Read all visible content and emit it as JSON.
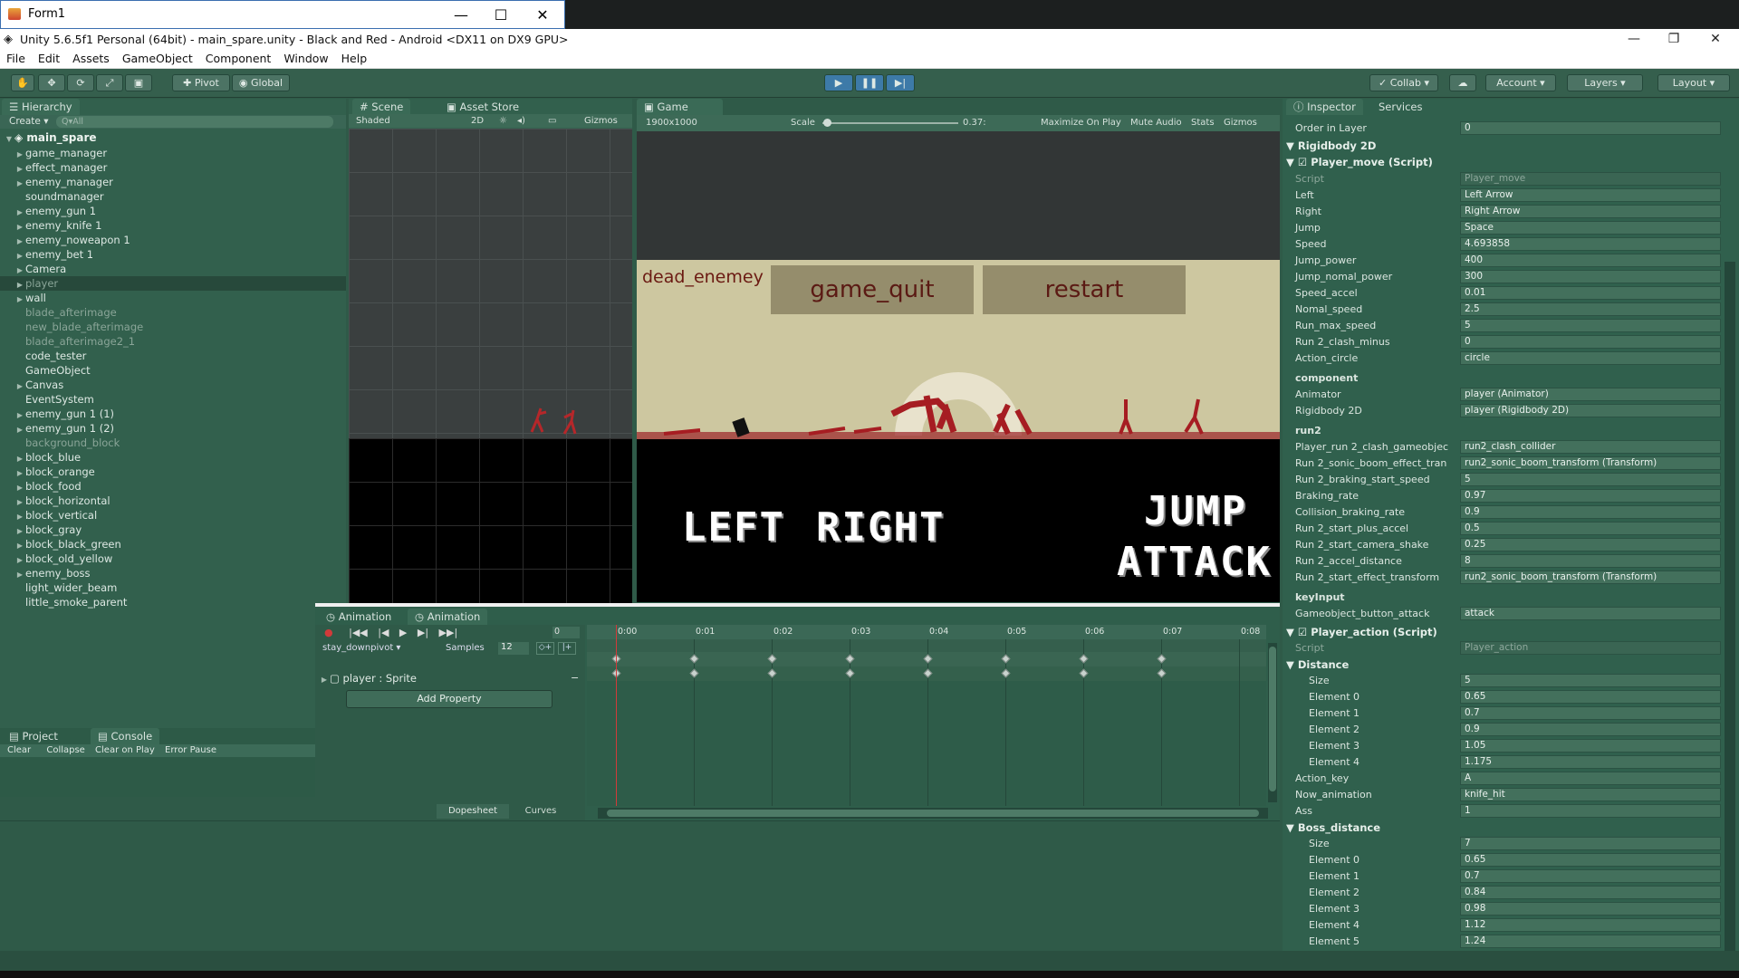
{
  "form_window": {
    "title": "Form1"
  },
  "unity_window": {
    "title": "Unity 5.6.5f1 Personal (64bit) - main_spare.unity - Black and Red - Android <DX11 on DX9 GPU>"
  },
  "menu": [
    "File",
    "Edit",
    "Assets",
    "GameObject",
    "Component",
    "Window",
    "Help"
  ],
  "toolbar": {
    "pivot": "Pivot",
    "global": "Global",
    "collab": "Collab",
    "account": "Account",
    "layers": "Layers",
    "layout": "Layout"
  },
  "hierarchy": {
    "tab": "Hierarchy",
    "create": "Create",
    "search_placeholder": "Q▾All",
    "root": "main_spare",
    "items": [
      {
        "label": "game_manager",
        "arrow": true,
        "dim": false
      },
      {
        "label": "effect_manager",
        "arrow": true,
        "dim": false
      },
      {
        "label": "enemy_manager",
        "arrow": true,
        "dim": false
      },
      {
        "label": "soundmanager",
        "arrow": false,
        "dim": false
      },
      {
        "label": "enemy_gun 1",
        "arrow": true,
        "dim": false
      },
      {
        "label": "enemy_knife 1",
        "arrow": true,
        "dim": false
      },
      {
        "label": "enemy_noweapon 1",
        "arrow": true,
        "dim": false
      },
      {
        "label": "enemy_bet 1",
        "arrow": true,
        "dim": false
      },
      {
        "label": "Camera",
        "arrow": true,
        "dim": false
      },
      {
        "label": "player",
        "arrow": true,
        "dim": true,
        "selected": true
      },
      {
        "label": "wall",
        "arrow": true,
        "dim": false
      },
      {
        "label": "blade_afterimage",
        "arrow": false,
        "dim": true
      },
      {
        "label": "new_blade_afterimage",
        "arrow": false,
        "dim": true
      },
      {
        "label": "blade_afterimage2_1",
        "arrow": false,
        "dim": true
      },
      {
        "label": "code_tester",
        "arrow": false,
        "dim": false
      },
      {
        "label": "GameObject",
        "arrow": false,
        "dim": false
      },
      {
        "label": "Canvas",
        "arrow": true,
        "dim": false
      },
      {
        "label": "EventSystem",
        "arrow": false,
        "dim": false
      },
      {
        "label": "enemy_gun 1 (1)",
        "arrow": true,
        "dim": false
      },
      {
        "label": "enemy_gun 1 (2)",
        "arrow": true,
        "dim": false
      },
      {
        "label": "background_block",
        "arrow": false,
        "dim": true
      },
      {
        "label": "block_blue",
        "arrow": true,
        "dim": false
      },
      {
        "label": "block_orange",
        "arrow": true,
        "dim": false
      },
      {
        "label": "block_food",
        "arrow": true,
        "dim": false
      },
      {
        "label": "block_horizontal",
        "arrow": true,
        "dim": false
      },
      {
        "label": "block_vertical",
        "arrow": true,
        "dim": false
      },
      {
        "label": "block_gray",
        "arrow": true,
        "dim": false
      },
      {
        "label": "block_black_green",
        "arrow": true,
        "dim": false
      },
      {
        "label": "block_old_yellow",
        "arrow": true,
        "dim": false
      },
      {
        "label": "enemy_boss",
        "arrow": true,
        "dim": false
      },
      {
        "label": "light_wider_beam",
        "arrow": false,
        "dim": false
      },
      {
        "label": "little_smoke_parent",
        "arrow": false,
        "dim": false
      }
    ]
  },
  "scene": {
    "tab": "Scene",
    "asset_tab": "Asset Store",
    "shaded": "Shaded",
    "mode2d": "2D",
    "gizmos": "Gizmos"
  },
  "game": {
    "tab": "Game",
    "resolution": "1900x1000",
    "scale_label": "Scale",
    "scale_value": "0.37:",
    "maximize": "Maximize On Play",
    "mute": "Mute Audio",
    "stats": "Stats",
    "gizmos": "Gizmos",
    "dead_label": "dead_enemey",
    "quit_btn": "game_quit",
    "restart_btn": "restart",
    "left": "LEFT",
    "right": "RIGHT",
    "jump": "JUMP",
    "attack": "ATTACK"
  },
  "project": {
    "tab": "Project",
    "console_tab": "Console",
    "clear": "Clear",
    "collapse": "Collapse",
    "clear_on_play": "Clear on Play",
    "error_pause": "Error Pause"
  },
  "animation": {
    "tab1": "Animation",
    "tab2": "Animation",
    "frame": "0",
    "clip": "stay_downpivot",
    "samples_label": "Samples",
    "samples": "12",
    "property": "player : Sprite",
    "add_property": "Add Property",
    "dopesheet": "Dopesheet",
    "curves": "Curves",
    "times": [
      "0:00",
      "0:01",
      "0:02",
      "0:03",
      "0:04",
      "0:05",
      "0:06",
      "0:07",
      "0:08"
    ]
  },
  "inspector": {
    "tab": "Inspector",
    "services_tab": "Services",
    "order_label": "Order in Layer",
    "order_value": "0",
    "rigidbody": "Rigidbody 2D",
    "player_move": "Player_move (Script)",
    "fields1": [
      {
        "label": "Script",
        "value": "Player_move",
        "dim": true
      },
      {
        "label": "Left",
        "value": "Left Arrow"
      },
      {
        "label": "Right",
        "value": "Right Arrow"
      },
      {
        "label": "Jump",
        "value": "Space"
      },
      {
        "label": "Speed",
        "value": "4.693858"
      },
      {
        "label": "Jump_power",
        "value": "400"
      },
      {
        "label": "Jump_nomal_power",
        "value": "300"
      },
      {
        "label": "Speed_accel",
        "value": "0.01"
      },
      {
        "label": "Nomal_speed",
        "value": "2.5"
      },
      {
        "label": "Run_max_speed",
        "value": "5"
      },
      {
        "label": "Run 2_clash_minus",
        "value": "0"
      },
      {
        "label": "Action_circle",
        "value": "circle"
      }
    ],
    "component_head": "component",
    "fields2": [
      {
        "label": "Animator",
        "value": "player (Animator)"
      },
      {
        "label": "Rigidbody 2D",
        "value": "player (Rigidbody 2D)"
      }
    ],
    "run2_head": "run2",
    "fields3": [
      {
        "label": "Player_run 2_clash_gameobjec",
        "value": "run2_clash_collider"
      },
      {
        "label": "Run 2_sonic_boom_effect_tran",
        "value": "run2_sonic_boom_transform (Transform)"
      },
      {
        "label": "Run 2_braking_start_speed",
        "value": "5"
      },
      {
        "label": "Braking_rate",
        "value": "0.97"
      },
      {
        "label": "Collision_braking_rate",
        "value": "0.9"
      },
      {
        "label": "Run 2_start_plus_accel",
        "value": "0.5"
      },
      {
        "label": "Run 2_start_camera_shake",
        "value": "0.25"
      },
      {
        "label": "Run 2_accel_distance",
        "value": "8"
      },
      {
        "label": "Run 2_start_effect_transform",
        "value": "run2_sonic_boom_transform (Transform)"
      }
    ],
    "keyinput_head": "keyInput",
    "fields4": [
      {
        "label": "Gameobject_button_attack",
        "value": "attack"
      }
    ],
    "player_action": "Player_action (Script)",
    "fields5": [
      {
        "label": "Script",
        "value": "Player_action",
        "dim": true
      }
    ],
    "distance_head": "Distance",
    "distance": [
      {
        "label": "Size",
        "value": "5"
      },
      {
        "label": "Element 0",
        "value": "0.65"
      },
      {
        "label": "Element 1",
        "value": "0.7"
      },
      {
        "label": "Element 2",
        "value": "0.9"
      },
      {
        "label": "Element 3",
        "value": "1.05"
      },
      {
        "label": "Element 4",
        "value": "1.175"
      }
    ],
    "fields6": [
      {
        "label": "Action_key",
        "value": "A"
      },
      {
        "label": "Now_animation",
        "value": "knife_hit"
      },
      {
        "label": "Ass",
        "value": "1"
      }
    ],
    "boss_head": "Boss_distance",
    "boss": [
      {
        "label": "Size",
        "value": "7"
      },
      {
        "label": "Element 0",
        "value": "0.65"
      },
      {
        "label": "Element 1",
        "value": "0.7"
      },
      {
        "label": "Element 2",
        "value": "0.84"
      },
      {
        "label": "Element 3",
        "value": "0.98"
      },
      {
        "label": "Element 4",
        "value": "1.12"
      },
      {
        "label": "Element 5",
        "value": "1.24"
      }
    ]
  }
}
